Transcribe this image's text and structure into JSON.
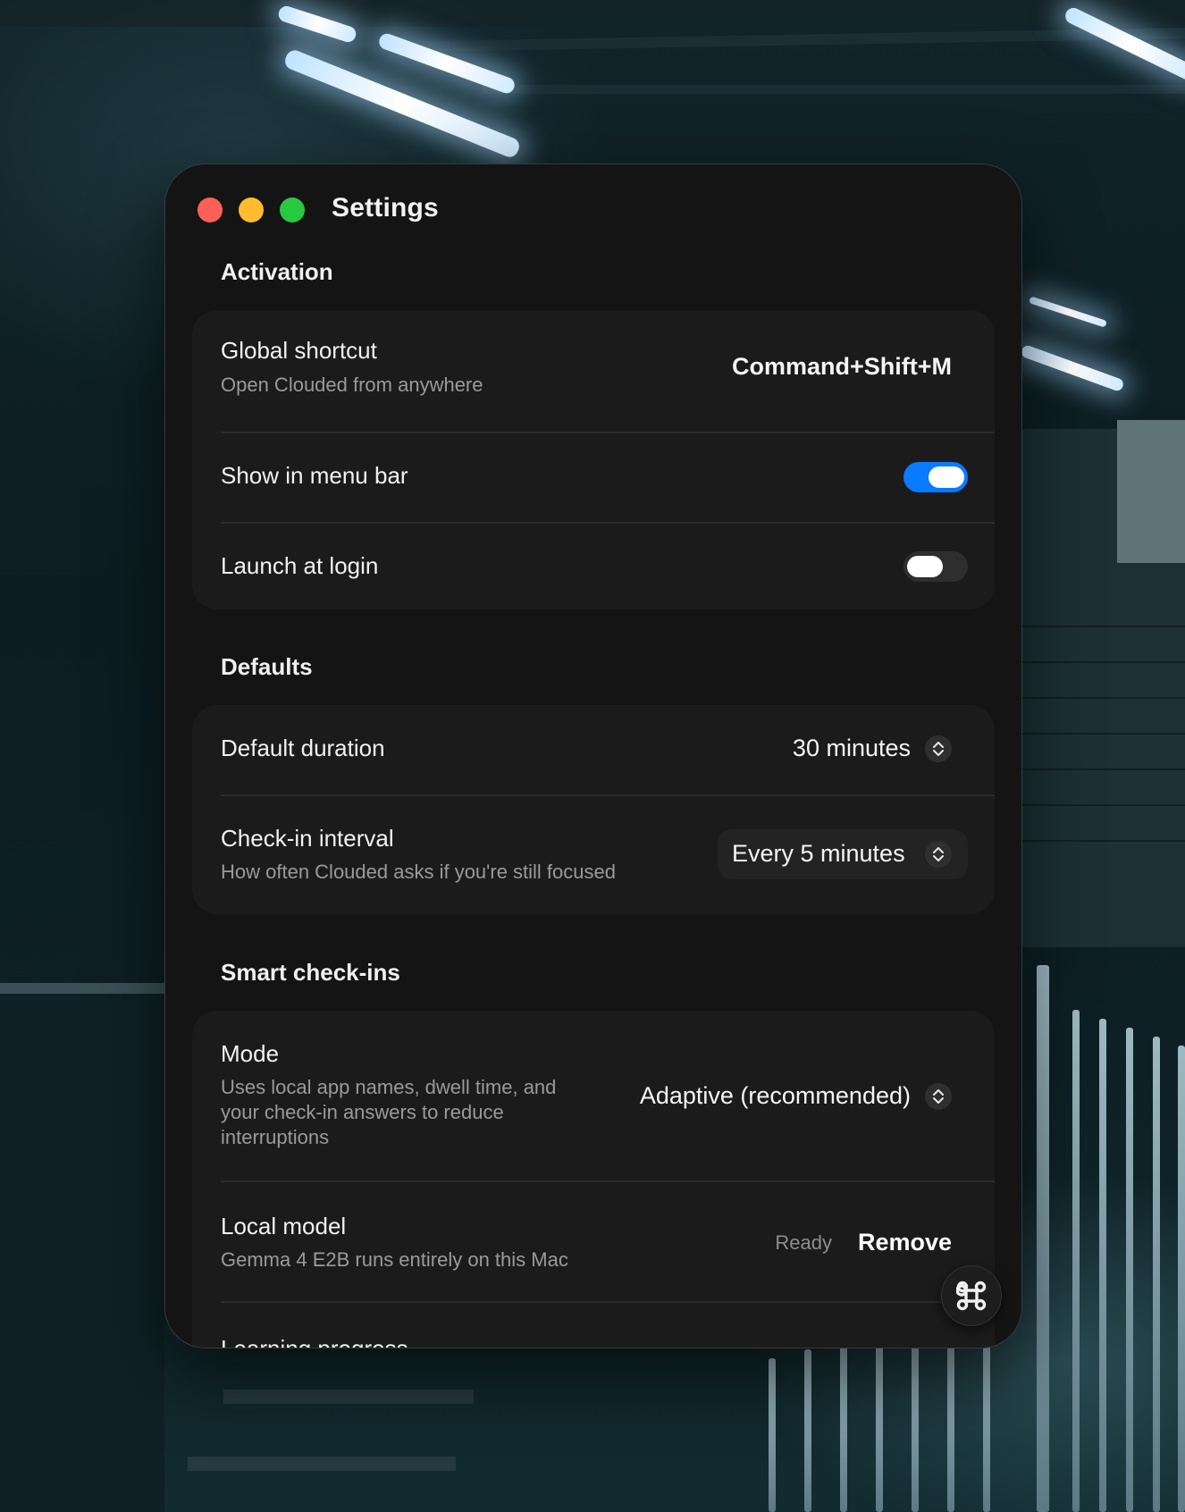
{
  "window": {
    "title": "Settings"
  },
  "activation": {
    "title": "Activation",
    "global_shortcut": {
      "label": "Global shortcut",
      "description": "Open Clouded from anywhere",
      "value": "Command+Shift+M"
    },
    "show_in_menu_bar": {
      "label": "Show in menu bar",
      "enabled": true
    },
    "launch_at_login": {
      "label": "Launch at login",
      "enabled": false
    }
  },
  "defaults": {
    "title": "Defaults",
    "default_duration": {
      "label": "Default duration",
      "value": "30 minutes"
    },
    "check_in_interval": {
      "label": "Check-in interval",
      "description": "How often Clouded asks if you're still focused",
      "value": "Every 5 minutes"
    }
  },
  "smart_checkins": {
    "title": "Smart check-ins",
    "mode": {
      "label": "Mode",
      "description": "Uses local app names, dwell time, and your check-in answers to reduce interruptions",
      "value": "Adaptive (recommended)"
    },
    "local_model": {
      "label": "Local model",
      "description": "Gemma 4 E2B runs entirely on this Mac",
      "status": "Ready",
      "action": "Remove"
    },
    "learning_progress": {
      "label": "Learning progress"
    }
  },
  "colors": {
    "accent": "#0a7bff",
    "close": "#fe5f57",
    "minimize": "#febc2e",
    "zoom": "#28c840"
  },
  "icons": {
    "stepper": "chevron-up-down-icon",
    "fab": "command-key-icon"
  }
}
